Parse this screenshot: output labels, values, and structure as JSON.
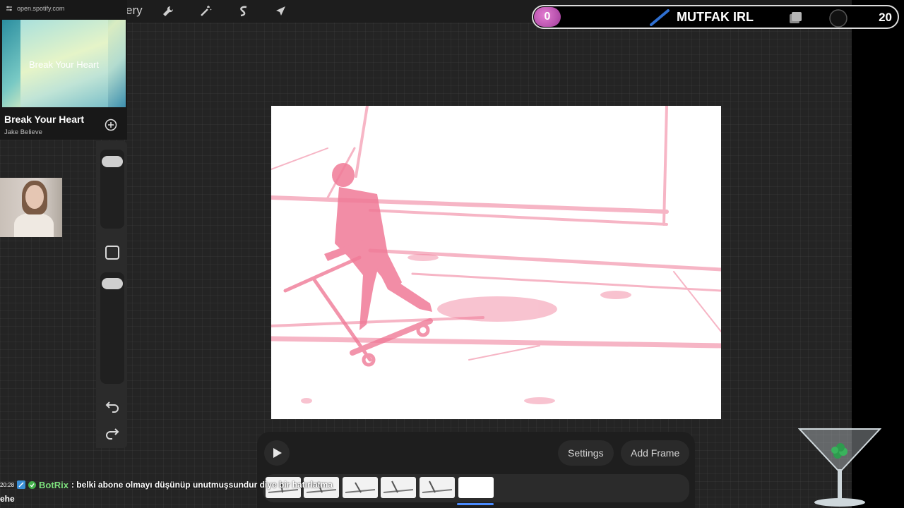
{
  "toolbar": {
    "gallery_label": "ery",
    "tools": [
      "wrench-icon",
      "magic-wand-icon",
      "selection-icon",
      "transform-arrow-icon"
    ]
  },
  "spotify": {
    "url": "open.spotify.com",
    "cover_title": "Break Your Heart",
    "track_title": "Break Your Heart",
    "artist": "Jake Believe"
  },
  "overlay": {
    "left_score": "0",
    "title": "MUTFAK IRL",
    "right_score": "20",
    "left_color": "#c45ab8"
  },
  "animation": {
    "settings_label": "Settings",
    "add_frame_label": "Add Frame",
    "frame_count": 6,
    "active_frame": 6
  },
  "chat": {
    "time": "20:28",
    "user": "BotRix",
    "message": ": belki abone olmayı düşünüp unutmuşsundur diye bir hatırlatma",
    "message2": "ehe",
    "user_color": "#7de07d"
  },
  "colors": {
    "sketch": "#f07a97",
    "canvas_bg": "#242424",
    "accent": "#4a8bff"
  }
}
